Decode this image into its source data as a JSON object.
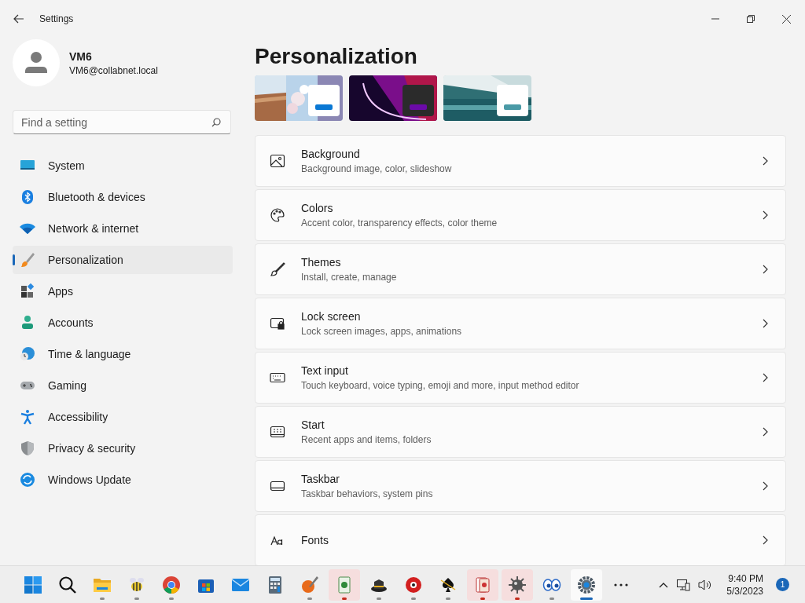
{
  "window": {
    "title": "Settings"
  },
  "profile": {
    "name": "VM6",
    "email": "VM6@collabnet.local"
  },
  "search": {
    "placeholder": "Find a setting"
  },
  "nav": [
    {
      "label": "System",
      "kind": "system",
      "selected": false
    },
    {
      "label": "Bluetooth & devices",
      "kind": "bluetooth",
      "selected": false
    },
    {
      "label": "Network & internet",
      "kind": "network",
      "selected": false
    },
    {
      "label": "Personalization",
      "kind": "personalization",
      "selected": true
    },
    {
      "label": "Apps",
      "kind": "apps",
      "selected": false
    },
    {
      "label": "Accounts",
      "kind": "accounts",
      "selected": false
    },
    {
      "label": "Time & language",
      "kind": "time",
      "selected": false
    },
    {
      "label": "Gaming",
      "kind": "gaming",
      "selected": false
    },
    {
      "label": "Accessibility",
      "kind": "accessibility",
      "selected": false
    },
    {
      "label": "Privacy & security",
      "kind": "privacy",
      "selected": false
    },
    {
      "label": "Windows Update",
      "kind": "update",
      "selected": false
    }
  ],
  "page_title": "Personalization",
  "themes": [
    {
      "kind": "flowers",
      "dark": false,
      "color": "#0a78d4"
    },
    {
      "kind": "glow",
      "dark": true,
      "color": "#6b0aa8"
    },
    {
      "kind": "lake",
      "dark": false,
      "color": "#4a9aa6"
    }
  ],
  "settings": [
    {
      "kind": "background",
      "title": "Background",
      "description": "Background image, color, slideshow"
    },
    {
      "kind": "colors",
      "title": "Colors",
      "description": "Accent color, transparency effects, color theme"
    },
    {
      "kind": "themes",
      "title": "Themes",
      "description": "Install, create, manage"
    },
    {
      "kind": "lock",
      "title": "Lock screen",
      "description": "Lock screen images, apps, animations"
    },
    {
      "kind": "text",
      "title": "Text input",
      "description": "Touch keyboard, voice typing, emoji and more, input method editor"
    },
    {
      "kind": "start",
      "title": "Start",
      "description": "Recent apps and items, folders"
    },
    {
      "kind": "taskbar",
      "title": "Taskbar",
      "description": "Taskbar behaviors, system pins"
    },
    {
      "kind": "fonts",
      "title": "Fonts"
    }
  ],
  "taskbar": {
    "apps": [
      {
        "kind": "start",
        "running": false,
        "attention": false,
        "selected": false
      },
      {
        "kind": "search",
        "running": false,
        "attention": false,
        "selected": false
      },
      {
        "kind": "folder",
        "running": true,
        "attention": false,
        "selected": false
      },
      {
        "kind": "bee",
        "running": true,
        "attention": false,
        "selected": false
      },
      {
        "kind": "browser",
        "running": true,
        "attention": false,
        "selected": false
      },
      {
        "kind": "store",
        "running": false,
        "attention": false,
        "selected": false
      },
      {
        "kind": "mail",
        "running": false,
        "attention": false,
        "selected": false
      },
      {
        "kind": "calculator",
        "running": false,
        "attention": false,
        "selected": false
      },
      {
        "kind": "paint",
        "running": true,
        "attention": false,
        "selected": false
      },
      {
        "kind": "card",
        "running": true,
        "attention": true,
        "selected": false
      },
      {
        "kind": "hat",
        "running": true,
        "attention": false,
        "selected": false
      },
      {
        "kind": "ball",
        "running": true,
        "attention": false,
        "selected": false
      },
      {
        "kind": "spade",
        "running": true,
        "attention": false,
        "selected": false
      },
      {
        "kind": "cards",
        "running": true,
        "attention": true,
        "selected": false
      },
      {
        "kind": "mine",
        "running": true,
        "attention": true,
        "selected": false
      },
      {
        "kind": "eyes",
        "running": true,
        "attention": false,
        "selected": false
      },
      {
        "kind": "settings",
        "running": true,
        "attention": false,
        "selected": true
      },
      {
        "kind": "more",
        "running": false,
        "attention": false,
        "selected": false
      }
    ],
    "time": "9:40 PM",
    "date": "5/3/2023",
    "notifications": "1"
  }
}
